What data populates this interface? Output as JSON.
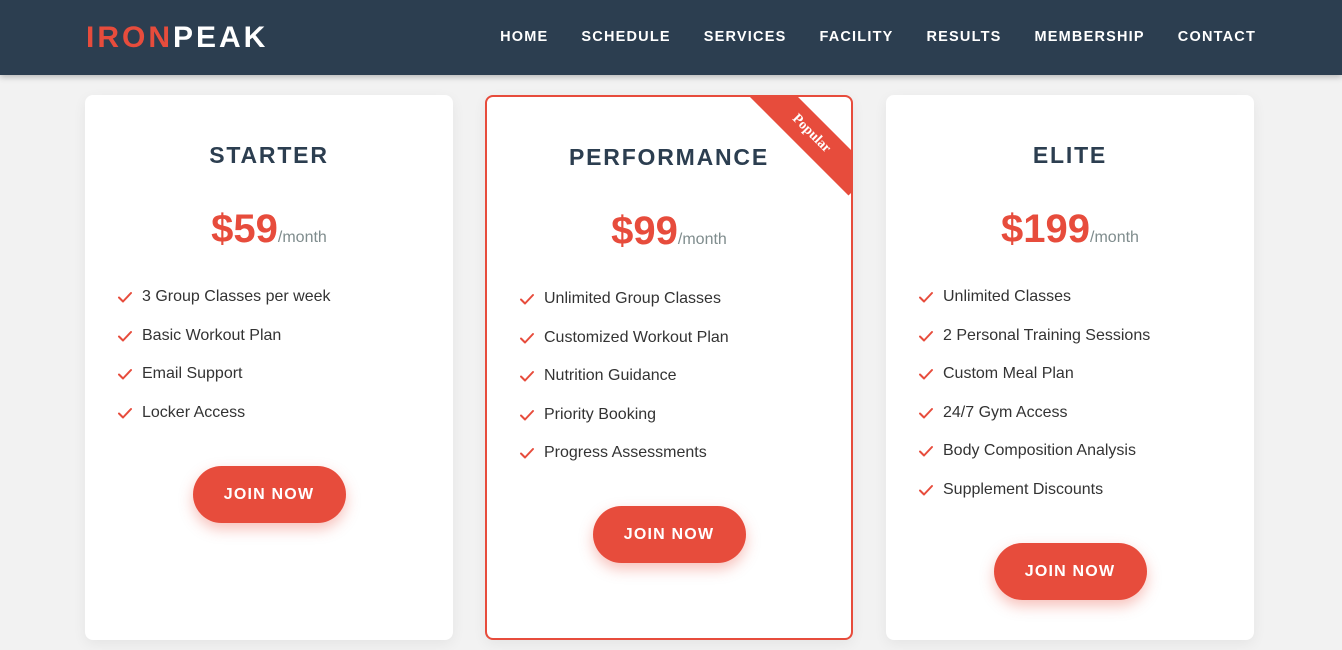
{
  "brand": {
    "part1": "IRON",
    "part2": "PEAK"
  },
  "nav": [
    "HOME",
    "SCHEDULE",
    "SERVICES",
    "FACILITY",
    "RESULTS",
    "MEMBERSHIP",
    "CONTACT"
  ],
  "colors": {
    "accent": "#e74c3c",
    "header_bg": "#2c3e50",
    "page_bg": "#f2f2f2",
    "title": "#2c3e50",
    "period": "#7f8c8d"
  },
  "plans": [
    {
      "name": "STARTER",
      "amount": "$59",
      "period": "/month",
      "features": [
        "3 Group Classes per week",
        "Basic Workout Plan",
        "Email Support",
        "Locker Access"
      ],
      "cta": "JOIN NOW"
    },
    {
      "name": "PERFORMANCE",
      "amount": "$99",
      "period": "/month",
      "badge": "Popular",
      "features": [
        "Unlimited Group Classes",
        "Customized Workout Plan",
        "Nutrition Guidance",
        "Priority Booking",
        "Progress Assessments"
      ],
      "cta": "JOIN NOW"
    },
    {
      "name": "ELITE",
      "amount": "$199",
      "period": "/month",
      "features": [
        "Unlimited Classes",
        "2 Personal Training Sessions",
        "Custom Meal Plan",
        "24/7 Gym Access",
        "Body Composition Analysis",
        "Supplement Discounts"
      ],
      "cta": "JOIN NOW"
    }
  ]
}
